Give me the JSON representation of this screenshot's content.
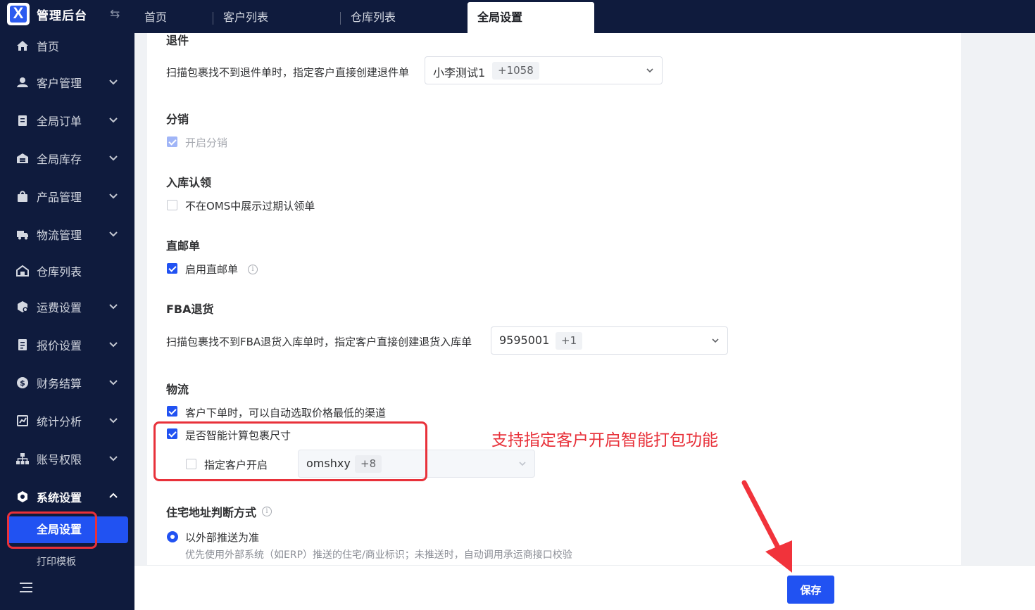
{
  "app": {
    "title": "管理后台"
  },
  "tabs": [
    {
      "label": "首页"
    },
    {
      "label": "客户列表"
    },
    {
      "label": "仓库列表"
    },
    {
      "label": "全局设置",
      "active": true
    }
  ],
  "sidebar": {
    "items": [
      {
        "label": "首页",
        "icon": "home-icon",
        "has_children": false
      },
      {
        "label": "客户管理",
        "icon": "user-icon",
        "has_children": true
      },
      {
        "label": "全局订单",
        "icon": "clipboard-icon",
        "has_children": true
      },
      {
        "label": "全局库存",
        "icon": "warehouse-icon",
        "has_children": true
      },
      {
        "label": "产品管理",
        "icon": "shopping-bag-icon",
        "has_children": true
      },
      {
        "label": "物流管理",
        "icon": "truck-icon",
        "has_children": true
      },
      {
        "label": "仓库列表",
        "icon": "building-icon",
        "has_children": false
      },
      {
        "label": "运费设置",
        "icon": "box-settings-icon",
        "has_children": true
      },
      {
        "label": "报价设置",
        "icon": "document-icon",
        "has_children": true
      },
      {
        "label": "财务结算",
        "icon": "dollar-icon",
        "has_children": true
      },
      {
        "label": "统计分析",
        "icon": "chart-icon",
        "has_children": true
      },
      {
        "label": "账号权限",
        "icon": "sitemap-icon",
        "has_children": true
      },
      {
        "label": "系统设置",
        "icon": "settings-icon",
        "has_children": true,
        "expanded": true
      }
    ],
    "active_sub": "全局设置",
    "next_sub": "打印模板"
  },
  "sections": {
    "return": {
      "title": "退件",
      "label": "扫描包裹找不到退件单时，指定客户直接创建退件单",
      "select_value": "小李测试1",
      "select_more": "+1058"
    },
    "distribution": {
      "title": "分销",
      "checkbox_label": "开启分销"
    },
    "inbound": {
      "title": "入库认领",
      "checkbox_label": "不在OMS中展示过期认领单"
    },
    "direct_mail": {
      "title": "直邮单",
      "checkbox_label": "启用直邮单"
    },
    "fba": {
      "title": "FBA退货",
      "label": "扫描包裹找不到FBA退货入库单时，指定客户直接创建退货入库单",
      "select_value": "9595001",
      "select_more": "+1"
    },
    "logistics": {
      "title": "物流",
      "cb1_label": "客户下单时，可以自动选取价格最低的渠道",
      "cb2_label": "是否智能计算包裹尺寸",
      "cb3_label": "指定客户开启",
      "select_value": "omshxy",
      "select_more": "+8"
    },
    "residential": {
      "title": "住宅地址判断方式",
      "radio_label": "以外部推送为准",
      "radio_hint": "优先使用外部系统（如ERP）推送的住宅/商业标识；未推送时，自动调用承运商接口校验"
    }
  },
  "annotation": {
    "text": "支持指定客户开启智能打包功能",
    "color": "#e8313a"
  },
  "footer": {
    "save_label": "保存"
  },
  "colors": {
    "primary": "#2152f2",
    "sidebar_bg": "#0f1b3d",
    "annotation": "#e8313a"
  }
}
